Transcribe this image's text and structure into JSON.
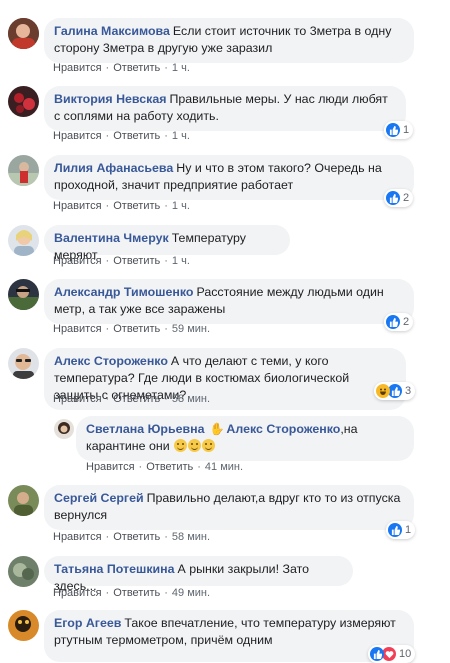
{
  "actions": {
    "like": "Нравится",
    "reply": "Ответить",
    "separator": "·"
  },
  "comments": [
    {
      "author": "Галина Максимова",
      "text": "Если стоит источник то 3метра в одну сторону 3метра в другую уже заразил",
      "time": "1 ч.",
      "reactions": null
    },
    {
      "author": "Виктория Невская",
      "text": "Правильные меры. У нас люди любят с соплями на работу ходить.",
      "time": "1 ч.",
      "reactions": "1"
    },
    {
      "author": "Лилия Афанасьева",
      "text": "Ну и что в этом такого? Очередь на проходной, значит предприятие работает",
      "time": "1 ч.",
      "reactions": "2"
    },
    {
      "author": "Валентина Чмерук",
      "text": "Температуру меряют",
      "time": "1 ч.",
      "reactions": null
    },
    {
      "author": "Александр Тимошенко",
      "text": "Расстояние между людьми один метр, а так уже все заражены",
      "time": "59 мин.",
      "reactions": "2"
    },
    {
      "author": "Алекс Стороженко",
      "text": "А что делают с теми, у кого температура? Где люди в костюмах биологической защиты с огнеметами?",
      "time": "58 мин.",
      "reactions": "3"
    },
    {
      "author": "Светлана Юрьевна",
      "mention": "Алекс Стороженко",
      "text": ",на карантине они",
      "time": "41 мин.",
      "reactions": null
    },
    {
      "author": "Сергей Сергей",
      "text": "Правильно делают,а вдруг кто то из отпуска вернулся",
      "time": "58 мин.",
      "reactions": "1"
    },
    {
      "author": "Татьяна Потешкина",
      "text": "А рынки закрыли! Зато здесь...",
      "time": "49 мин.",
      "reactions": null
    },
    {
      "author": "Егор Агеев",
      "text": "Такое впечатление, что температуру измеряют ртутным термометром, причём одним",
      "time": "",
      "reactions": "10"
    }
  ]
}
